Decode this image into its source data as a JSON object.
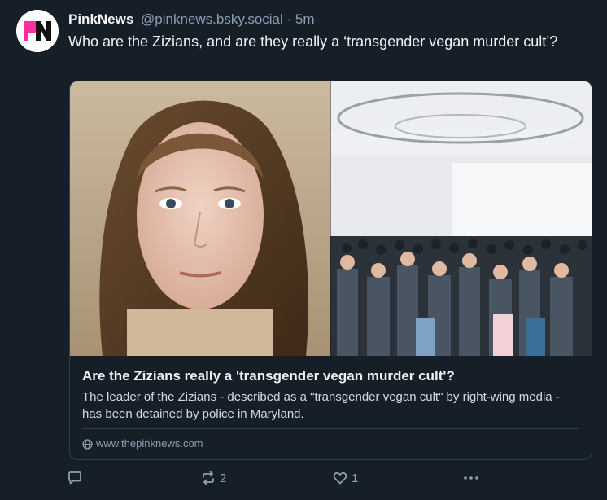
{
  "post": {
    "author": {
      "display_name": "PinkNews",
      "handle": "@pinknews.bsky.social",
      "separator": "·",
      "timestamp": "5m",
      "avatar_icon": "pinknews-logo-icon",
      "avatar_logo_text": "PN",
      "brand_color": "#ff2e9f"
    },
    "text": "Who are the Zizians, and are they really a ‘transgender vegan murder cult’?",
    "embed": {
      "title": "Are the Zizians really a 'transgender vegan murder cult'?",
      "description": "The leader of the Zizians - described as a \"transgender vegan cult\" by right-wing media - has been detained by police in Maryland.",
      "domain": "www.thepinknews.com",
      "domain_icon": "globe-icon",
      "image_left": "portrait photo",
      "image_right": "crowd photo"
    },
    "actions": {
      "reply": {
        "icon": "reply-icon",
        "count": ""
      },
      "repost": {
        "icon": "repost-icon",
        "count": "2"
      },
      "like": {
        "icon": "heart-icon",
        "count": "1"
      },
      "more": {
        "icon": "more-icon"
      }
    }
  },
  "colors": {
    "background": "#161e27",
    "text_primary": "#f1f3f5",
    "text_secondary": "#8d9fb3",
    "border": "#2e4052"
  }
}
